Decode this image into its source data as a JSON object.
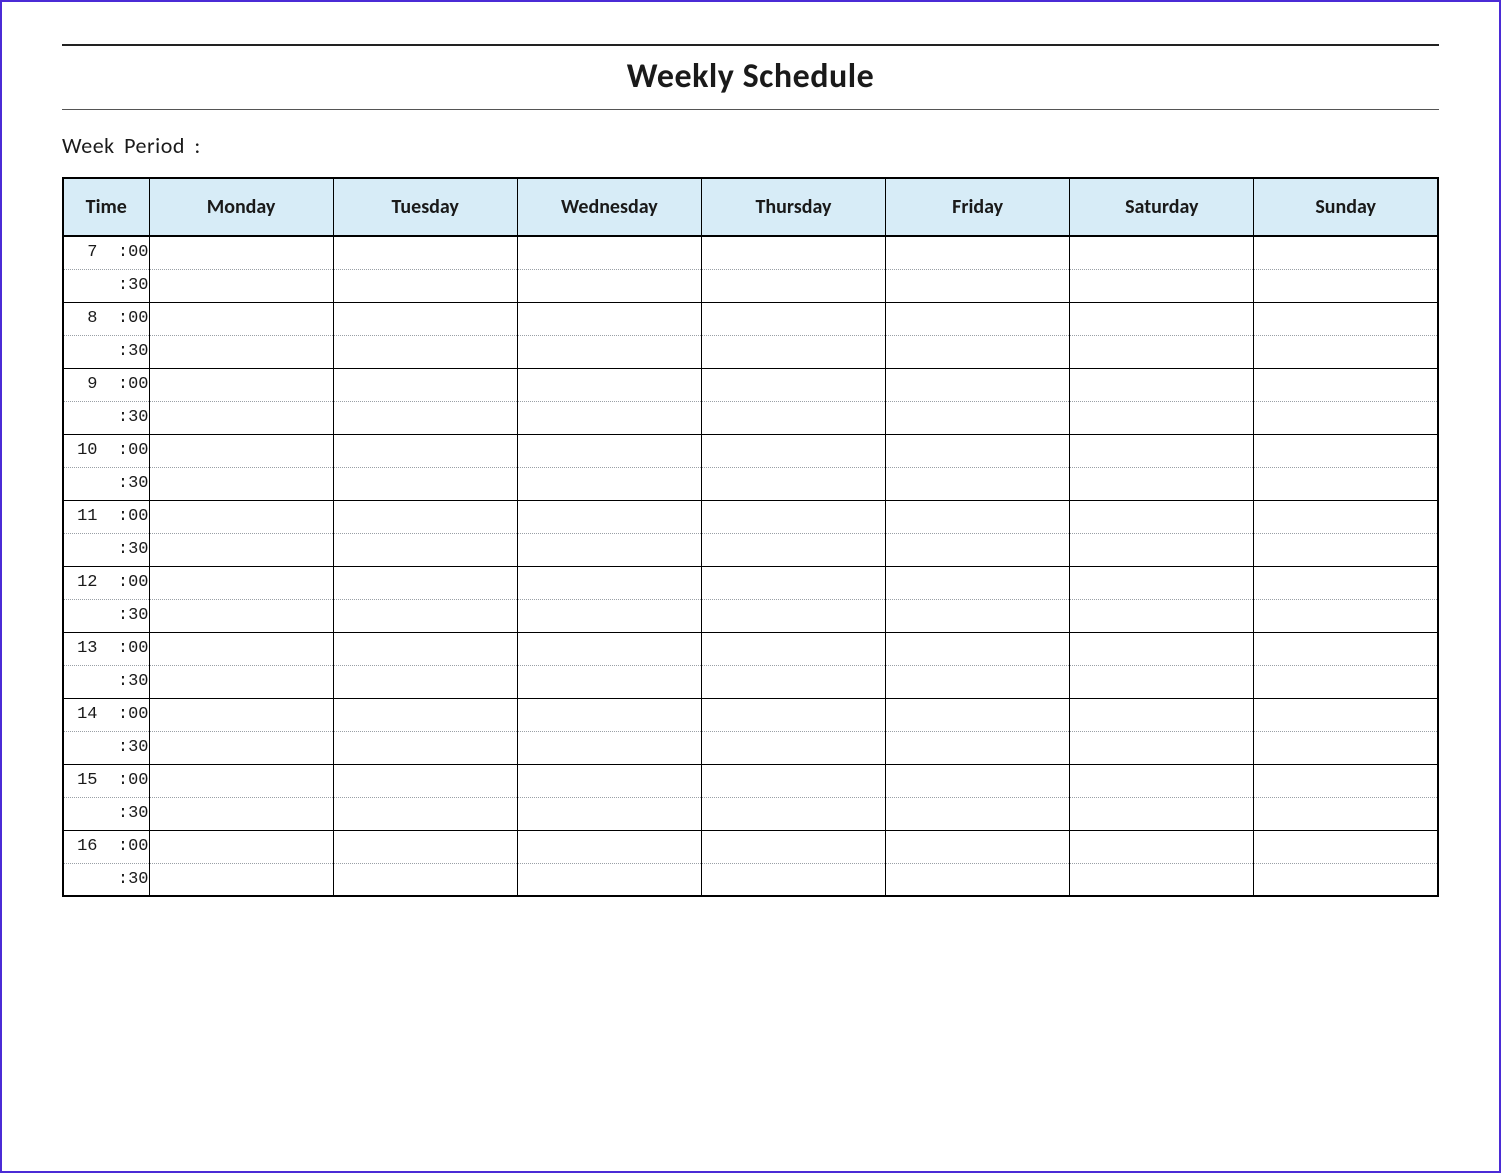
{
  "title": "Weekly Schedule",
  "week_period_label": "Week  Period :",
  "columns": {
    "time": "Time",
    "days": [
      "Monday",
      "Tuesday",
      "Wednesday",
      "Thursday",
      "Friday",
      "Saturday",
      "Sunday"
    ]
  },
  "time_slots": [
    {
      "label": "7  :00",
      "is_hour": false
    },
    {
      "label": ":30",
      "is_hour": true
    },
    {
      "label": "8  :00",
      "is_hour": false
    },
    {
      "label": ":30",
      "is_hour": true
    },
    {
      "label": "9  :00",
      "is_hour": false
    },
    {
      "label": ":30",
      "is_hour": true
    },
    {
      "label": "10  :00",
      "is_hour": false
    },
    {
      "label": ":30",
      "is_hour": true
    },
    {
      "label": "11  :00",
      "is_hour": false
    },
    {
      "label": ":30",
      "is_hour": true
    },
    {
      "label": "12  :00",
      "is_hour": false
    },
    {
      "label": ":30",
      "is_hour": true
    },
    {
      "label": "13  :00",
      "is_hour": false
    },
    {
      "label": ":30",
      "is_hour": true
    },
    {
      "label": "14  :00",
      "is_hour": false
    },
    {
      "label": ":30",
      "is_hour": true
    },
    {
      "label": "15  :00",
      "is_hour": false
    },
    {
      "label": ":30",
      "is_hour": true
    },
    {
      "label": "16  :00",
      "is_hour": false
    },
    {
      "label": ":30",
      "is_hour": true
    }
  ],
  "colors": {
    "header_bg": "#d7ecf7",
    "frame_border": "#4b2bd6"
  }
}
